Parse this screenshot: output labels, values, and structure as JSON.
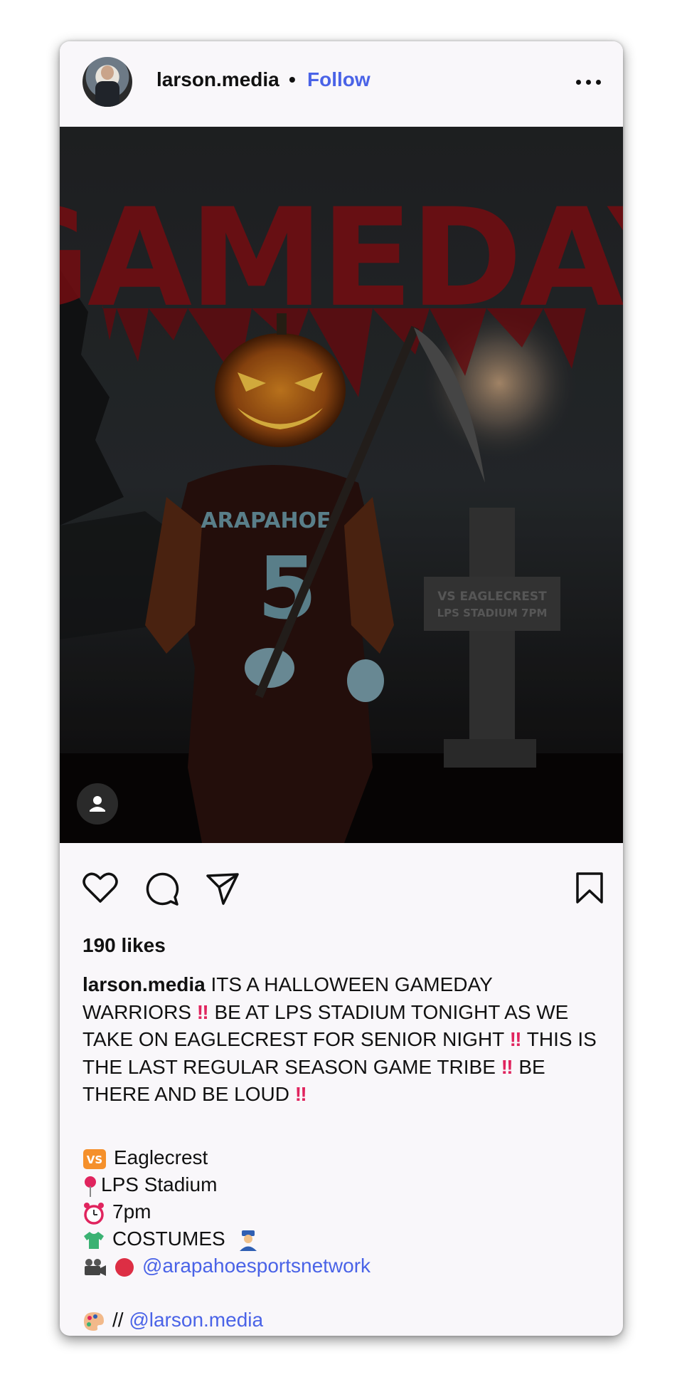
{
  "post": {
    "username": "larson.media",
    "separator": "•",
    "follow_label": "Follow"
  },
  "image": {
    "headline": "GAMEDAY",
    "jersey_text": "ARAPAHOE",
    "jersey_number": "5",
    "tombstone_line1": "VS EAGLECREST",
    "tombstone_line2": "LPS STADIUM 7PM"
  },
  "stats": {
    "likes": "190 likes"
  },
  "caption": {
    "username": "larson.media",
    "part1": " ITS A HALLOWEEN GAMEDAY WARRIORS ",
    "part2": " BE AT LPS STADIUM TONIGHT AS WE TAKE ON EAGLECREST FOR SENIOR NIGHT ",
    "part3": " THIS IS THE LAST REGULAR SEASON GAME TRIBE ",
    "part4": " BE THERE AND BE LOUD ",
    "exclaim": "‼",
    "details": {
      "vs_badge": "VS",
      "opponent": "Eaglecrest",
      "venue": "LPS Stadium",
      "time": "7pm",
      "attire": "COSTUMES",
      "stream_mention": "@arapahoesportsnetwork",
      "credit_sep": "//",
      "credit_mention": "@larson.media"
    }
  },
  "colors": {
    "accent": "#4a63e7",
    "exclaim": "#e0245e",
    "headline": "#8e1015"
  }
}
